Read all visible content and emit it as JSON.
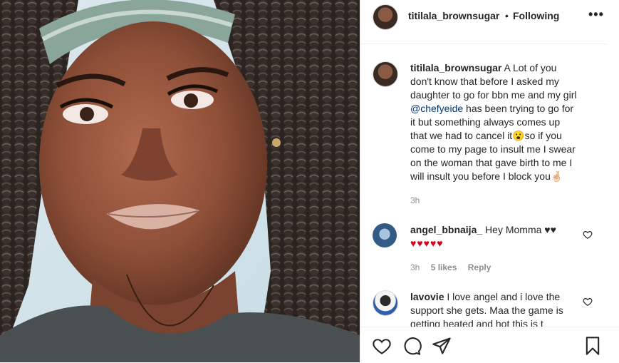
{
  "post": {
    "username": "titilala_brownsugar",
    "separator": "•",
    "follow_status": "Following",
    "more_label": "•••",
    "caption": {
      "username": "titilala_brownsugar",
      "text_before_mention": "A Lot of you don't know that before I asked my daughter to go for bbn me and my girl",
      "mention": "@chefyeide",
      "text_after_mention": "has been trying to go for it but something always comes up that we had to cancel it😮so if you come to my page to insult me I swear on the woman that gave birth to me I will insult you before I block you🤞🏻",
      "time": "3h"
    }
  },
  "comments": [
    {
      "username": "angel_bbnaija_",
      "text": "Hey Momma ♥♥",
      "text_line2": "♥♥♥♥♥",
      "time": "3h",
      "likes": "5 likes",
      "reply_label": "Reply"
    },
    {
      "username": "lavovie",
      "text": "I love angel and i love the support she gets. Maa the game is getting heated and hot this is t"
    }
  ],
  "colors": {
    "text": "#262626",
    "muted": "#8e8e8e",
    "link": "#00376b",
    "heart": "#d0021b",
    "divider": "#efefef"
  },
  "icons": {
    "like": "heart-outline-icon",
    "comment": "speech-bubble-icon",
    "share": "paper-plane-icon",
    "save": "bookmark-icon",
    "comment_like": "heart-outline-icon"
  }
}
